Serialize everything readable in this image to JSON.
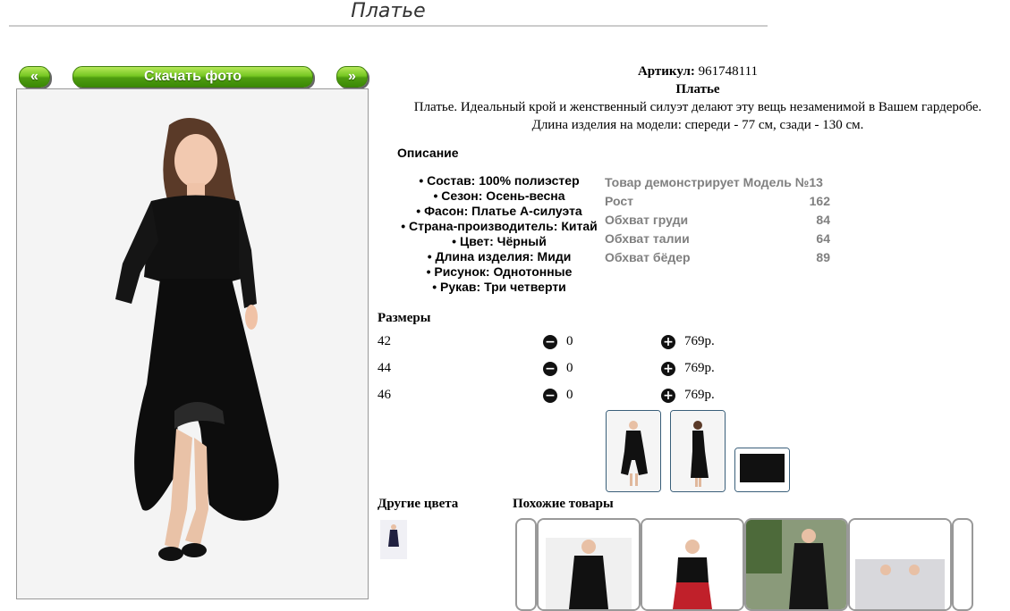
{
  "header": {
    "title": "Платье"
  },
  "gallery": {
    "prev_label": "«",
    "next_label": "»",
    "download_label": "Скачать фото"
  },
  "product": {
    "article_label": "Артикул:",
    "article_value": "961748111",
    "name": "Платье",
    "description_1": "Платье. Идеальный крой и женственный силуэт делают эту вещь незаменимой в Вашем гардеробе.",
    "description_2": "Длина изделия на модели: спереди - 77 см, сзади - 130 см."
  },
  "description": {
    "heading": "Описание",
    "properties": [
      "Состав: 100% полиэстер",
      "Сезон: Осень-весна",
      "Фасон: Платье А-силуэта",
      "Страна-производитель: Китай",
      "Цвет: Чёрный",
      "Длина изделия: Миди",
      "Рисунок: Однотонные",
      "Рукав: Три четверти"
    ]
  },
  "model": {
    "title": "Товар демонстрирует Модель №13",
    "rows": [
      {
        "label": "Рост",
        "value": "162"
      },
      {
        "label": "Обхват груди",
        "value": "84"
      },
      {
        "label": "Обхват талии",
        "value": "64"
      },
      {
        "label": "Обхват бёдер",
        "value": "89"
      }
    ]
  },
  "sizes": {
    "heading": "Размеры",
    "rows": [
      {
        "size": "42",
        "qty": "0",
        "price": "769р."
      },
      {
        "size": "44",
        "qty": "0",
        "price": "769р."
      },
      {
        "size": "46",
        "qty": "0",
        "price": "769р."
      }
    ]
  },
  "related": {
    "other_colors_label": "Другие цвета",
    "similar_label": "Похожие товары"
  },
  "icons": {
    "minus": "minus-circle-icon",
    "plus": "plus-circle-icon"
  },
  "colors": {
    "accent_green": "#5aa815",
    "thumb_border": "#3a5f7a",
    "muted_text": "#808080"
  }
}
